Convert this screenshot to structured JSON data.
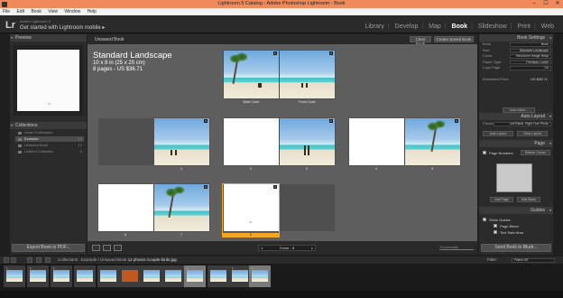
{
  "window": {
    "title": "Lightroom 5 Catalog - Adobe Photoshop Lightroom - Book",
    "minimize": "–",
    "maximize": "☐",
    "close": "✕"
  },
  "menu": [
    "File",
    "Edit",
    "Book",
    "View",
    "Window",
    "Help"
  ],
  "identity": {
    "logo": "Lr",
    "small": "Adobe Lightroom 5",
    "big": "Get started with Lightroom mobile ▸"
  },
  "modules": {
    "items": [
      "Library",
      "Develop",
      "Map",
      "Book",
      "Slideshow",
      "Print",
      "Web"
    ],
    "active": "Book"
  },
  "left_panel": {
    "preview_label": "Preview",
    "preview_page_num": "20",
    "collections_label": "Collections",
    "collections": [
      {
        "name": "Smart Collections",
        "count": ""
      },
      {
        "name": "Example",
        "count": "12"
      },
      {
        "name": "Unsaved Book",
        "count": "12"
      },
      {
        "name": "Untitled Collection",
        "count": "0"
      }
    ],
    "export_button": "Export Book to PDF..."
  },
  "center": {
    "book_name": "Unsaved Book",
    "clear_book": "Clear Book",
    "create_saved_book": "Create Saved Book",
    "title": "Standard Landscape",
    "size": "10 x 8 in (25 x 20 cm)",
    "info": "8 pages - US $36.71",
    "cover_labels": [
      "Back Cover",
      "Front Cover"
    ],
    "page_numbers": [
      "1",
      "2",
      "3",
      "4",
      "5",
      "6",
      "7",
      "8"
    ],
    "badges": [
      "1",
      "1",
      "1",
      "1",
      "1",
      "1",
      "1"
    ],
    "preview_page_num": "20"
  },
  "toolbar": {
    "page_nav": "Cover - 8",
    "prev": "◂",
    "next": "▸",
    "thumbnails_label": "Thumbnails"
  },
  "right_panel": {
    "book_settings": "Book Settings",
    "settings": [
      {
        "label": "Book",
        "value": "Book"
      },
      {
        "label": "Size",
        "value": "Standard Landscape"
      },
      {
        "label": "Cover",
        "value": "Hardcover Image Wrap"
      },
      {
        "label": "Paper Type",
        "value": "Premium Lustre"
      },
      {
        "label": "Logo Page",
        "value": "On"
      }
    ],
    "estimated_price_label": "Estimated Price:",
    "estimated_price": "US $36.71",
    "learn_more": "Learn More...",
    "auto_layout": "Auto Layout",
    "preset_label": "Preset:",
    "preset_value": "Left Blank, Right One Photo",
    "auto_layout_btn": "Auto Layout",
    "clear_layout_btn": "Clear Layout",
    "page": "Page",
    "page_numbers_label": "Page Numbers",
    "page_numbers_value": "Bottom Corner",
    "add_page": "Add Page",
    "add_blank": "Add Blank",
    "guides": "Guides",
    "guide_items": [
      "Show Guides",
      "Page Bleed",
      "Text Safe Area"
    ],
    "send_button": "Send Book to Blurb..."
  },
  "filmstrip": {
    "path": "Collections : Example / Unsaved Book",
    "count": "12 photos /couple-birds.jpg",
    "filter_label": "Filter:",
    "filter_value": "Filters Off",
    "cells": [
      {
        "num": "1",
        "sel": false
      },
      {
        "num": "1",
        "sel": false
      },
      {
        "num": "1",
        "sel": false
      },
      {
        "num": "",
        "sel": false
      },
      {
        "num": "",
        "sel": false
      },
      {
        "num": "",
        "sel": false
      },
      {
        "num": "",
        "sel": false
      },
      {
        "num": "1",
        "sel": true
      },
      {
        "num": "",
        "sel": false
      },
      {
        "num": "",
        "sel": false
      },
      {
        "num": "1",
        "sel": false
      },
      {
        "num": "1",
        "sel": true
      }
    ],
    "dots": "• • •"
  },
  "colors": {
    "titlebar": "#f08a5a",
    "selection": "#f3a524",
    "canvas": "#5e5e5e"
  }
}
